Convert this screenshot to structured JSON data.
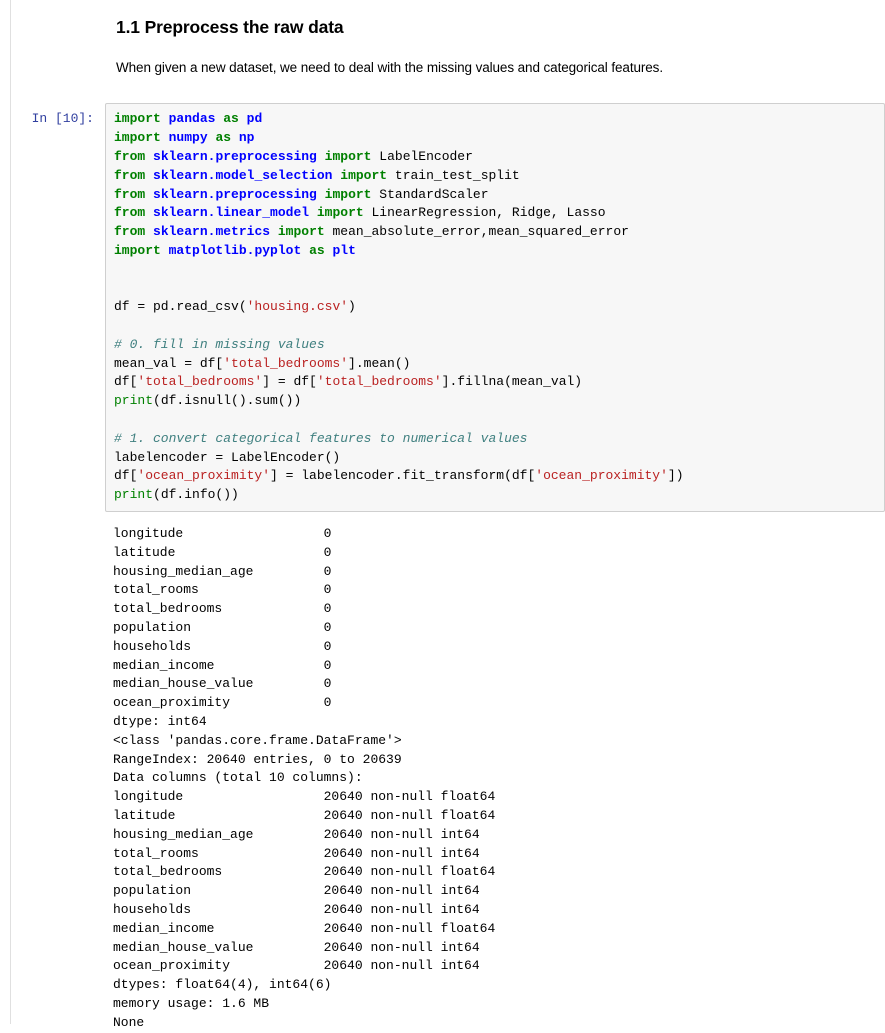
{
  "markdown_cell": {
    "heading": "1.1 Preprocess the raw data",
    "paragraph": "When given a new dataset, we need to deal with the missing values and categorical features."
  },
  "code_cell": {
    "prompt": "In [10]:",
    "execution_count": 10,
    "language": "python",
    "source": "import pandas as pd\nimport numpy as np\nfrom sklearn.preprocessing import LabelEncoder\nfrom sklearn.model_selection import train_test_split\nfrom sklearn.preprocessing import StandardScaler\nfrom sklearn.linear_model import LinearRegression, Ridge, Lasso\nfrom sklearn.metrics import mean_absolute_error,mean_squared_error\nimport matplotlib.pyplot as plt\n\n\ndf = pd.read_csv('housing.csv')\n\n# 0. fill in missing values\nmean_val = df['total_bedrooms'].mean()\ndf['total_bedrooms'] = df['total_bedrooms'].fillna(mean_val)\nprint(df.isnull().sum())\n\n# 1. convert categorical features to numerical values\nlabelencoder = LabelEncoder()\ndf['ocean_proximity'] = labelencoder.fit_transform(df['ocean_proximity'])\nprint(df.info())",
    "lines": [
      {
        "tokens": [
          {
            "t": "import",
            "c": "k"
          },
          {
            "t": " ",
            "c": "n"
          },
          {
            "t": "pandas",
            "c": "nn"
          },
          {
            "t": " ",
            "c": "n"
          },
          {
            "t": "as",
            "c": "k"
          },
          {
            "t": " ",
            "c": "n"
          },
          {
            "t": "pd",
            "c": "nn"
          }
        ]
      },
      {
        "tokens": [
          {
            "t": "import",
            "c": "k"
          },
          {
            "t": " ",
            "c": "n"
          },
          {
            "t": "numpy",
            "c": "nn"
          },
          {
            "t": " ",
            "c": "n"
          },
          {
            "t": "as",
            "c": "k"
          },
          {
            "t": " ",
            "c": "n"
          },
          {
            "t": "np",
            "c": "nn"
          }
        ]
      },
      {
        "tokens": [
          {
            "t": "from",
            "c": "k"
          },
          {
            "t": " ",
            "c": "n"
          },
          {
            "t": "sklearn.preprocessing",
            "c": "nn"
          },
          {
            "t": " ",
            "c": "n"
          },
          {
            "t": "import",
            "c": "k"
          },
          {
            "t": " LabelEncoder",
            "c": "n"
          }
        ]
      },
      {
        "tokens": [
          {
            "t": "from",
            "c": "k"
          },
          {
            "t": " ",
            "c": "n"
          },
          {
            "t": "sklearn.model_selection",
            "c": "nn"
          },
          {
            "t": " ",
            "c": "n"
          },
          {
            "t": "import",
            "c": "k"
          },
          {
            "t": " train_test_split",
            "c": "n"
          }
        ]
      },
      {
        "tokens": [
          {
            "t": "from",
            "c": "k"
          },
          {
            "t": " ",
            "c": "n"
          },
          {
            "t": "sklearn.preprocessing",
            "c": "nn"
          },
          {
            "t": " ",
            "c": "n"
          },
          {
            "t": "import",
            "c": "k"
          },
          {
            "t": " StandardScaler",
            "c": "n"
          }
        ]
      },
      {
        "tokens": [
          {
            "t": "from",
            "c": "k"
          },
          {
            "t": " ",
            "c": "n"
          },
          {
            "t": "sklearn.linear_model",
            "c": "nn"
          },
          {
            "t": " ",
            "c": "n"
          },
          {
            "t": "import",
            "c": "k"
          },
          {
            "t": " LinearRegression, Ridge, Lasso",
            "c": "n"
          }
        ]
      },
      {
        "tokens": [
          {
            "t": "from",
            "c": "k"
          },
          {
            "t": " ",
            "c": "n"
          },
          {
            "t": "sklearn.metrics",
            "c": "nn"
          },
          {
            "t": " ",
            "c": "n"
          },
          {
            "t": "import",
            "c": "k"
          },
          {
            "t": " mean_absolute_error,mean_squared_error",
            "c": "n"
          }
        ]
      },
      {
        "tokens": [
          {
            "t": "import",
            "c": "k"
          },
          {
            "t": " ",
            "c": "n"
          },
          {
            "t": "matplotlib.pyplot",
            "c": "nn"
          },
          {
            "t": " ",
            "c": "n"
          },
          {
            "t": "as",
            "c": "k"
          },
          {
            "t": " ",
            "c": "n"
          },
          {
            "t": "plt",
            "c": "nn"
          }
        ]
      },
      {
        "tokens": []
      },
      {
        "tokens": []
      },
      {
        "tokens": [
          {
            "t": "df = pd.read_csv(",
            "c": "n"
          },
          {
            "t": "'housing.csv'",
            "c": "s"
          },
          {
            "t": ")",
            "c": "n"
          }
        ]
      },
      {
        "tokens": []
      },
      {
        "tokens": [
          {
            "t": "# 0. fill in missing values",
            "c": "c"
          }
        ]
      },
      {
        "tokens": [
          {
            "t": "mean_val = df[",
            "c": "n"
          },
          {
            "t": "'total_bedrooms'",
            "c": "s"
          },
          {
            "t": "].mean()",
            "c": "n"
          }
        ]
      },
      {
        "tokens": [
          {
            "t": "df[",
            "c": "n"
          },
          {
            "t": "'total_bedrooms'",
            "c": "s"
          },
          {
            "t": "] = df[",
            "c": "n"
          },
          {
            "t": "'total_bedrooms'",
            "c": "s"
          },
          {
            "t": "].fillna(mean_val)",
            "c": "n"
          }
        ]
      },
      {
        "tokens": [
          {
            "t": "print",
            "c": "nb"
          },
          {
            "t": "(df.isnull().sum())",
            "c": "n"
          }
        ]
      },
      {
        "tokens": []
      },
      {
        "tokens": [
          {
            "t": "# 1. convert categorical features to numerical values",
            "c": "c"
          }
        ]
      },
      {
        "tokens": [
          {
            "t": "labelencoder = LabelEncoder()",
            "c": "n"
          }
        ]
      },
      {
        "tokens": [
          {
            "t": "df[",
            "c": "n"
          },
          {
            "t": "'ocean_proximity'",
            "c": "s"
          },
          {
            "t": "] = labelencoder.fit_transform(df[",
            "c": "n"
          },
          {
            "t": "'ocean_proximity'",
            "c": "s"
          },
          {
            "t": "])",
            "c": "n"
          }
        ]
      },
      {
        "tokens": [
          {
            "t": "print",
            "c": "nb"
          },
          {
            "t": "(df.info())",
            "c": "n"
          }
        ]
      }
    ]
  },
  "output": {
    "stream": "stdout",
    "null_counts": {
      "rows": [
        {
          "column": "longitude",
          "count": "0"
        },
        {
          "column": "latitude",
          "count": "0"
        },
        {
          "column": "housing_median_age",
          "count": "0"
        },
        {
          "column": "total_rooms",
          "count": "0"
        },
        {
          "column": "total_bedrooms",
          "count": "0"
        },
        {
          "column": "population",
          "count": "0"
        },
        {
          "column": "households",
          "count": "0"
        },
        {
          "column": "median_income",
          "count": "0"
        },
        {
          "column": "median_house_value",
          "count": "0"
        },
        {
          "column": "ocean_proximity",
          "count": "0"
        }
      ],
      "dtype_line": "dtype: int64"
    },
    "info": {
      "class_line": "<class 'pandas.core.frame.DataFrame'>",
      "range_index": "RangeIndex: 20640 entries, 0 to 20639",
      "columns_header": "Data columns (total 10 columns):",
      "rows": [
        {
          "column": "longitude",
          "non_null": "20640 non-null",
          "dtype": "float64"
        },
        {
          "column": "latitude",
          "non_null": "20640 non-null",
          "dtype": "float64"
        },
        {
          "column": "housing_median_age",
          "non_null": "20640 non-null",
          "dtype": "int64"
        },
        {
          "column": "total_rooms",
          "non_null": "20640 non-null",
          "dtype": "int64"
        },
        {
          "column": "total_bedrooms",
          "non_null": "20640 non-null",
          "dtype": "float64"
        },
        {
          "column": "population",
          "non_null": "20640 non-null",
          "dtype": "int64"
        },
        {
          "column": "households",
          "non_null": "20640 non-null",
          "dtype": "int64"
        },
        {
          "column": "median_income",
          "non_null": "20640 non-null",
          "dtype": "float64"
        },
        {
          "column": "median_house_value",
          "non_null": "20640 non-null",
          "dtype": "int64"
        },
        {
          "column": "ocean_proximity",
          "non_null": "20640 non-null",
          "dtype": "int64"
        }
      ],
      "dtypes_line": "dtypes: float64(4), int64(6)",
      "memory_line": "memory usage: 1.6 MB",
      "none_line": "None"
    }
  },
  "colors": {
    "keyword": "#008000",
    "namespace": "#0000ff",
    "string": "#ba2121",
    "comment": "#408080",
    "builtin": "#008000",
    "prompt": "#303f9f",
    "code_background": "#f7f7f7",
    "code_border": "#cfcfcf",
    "page_background": "#ffffff"
  }
}
